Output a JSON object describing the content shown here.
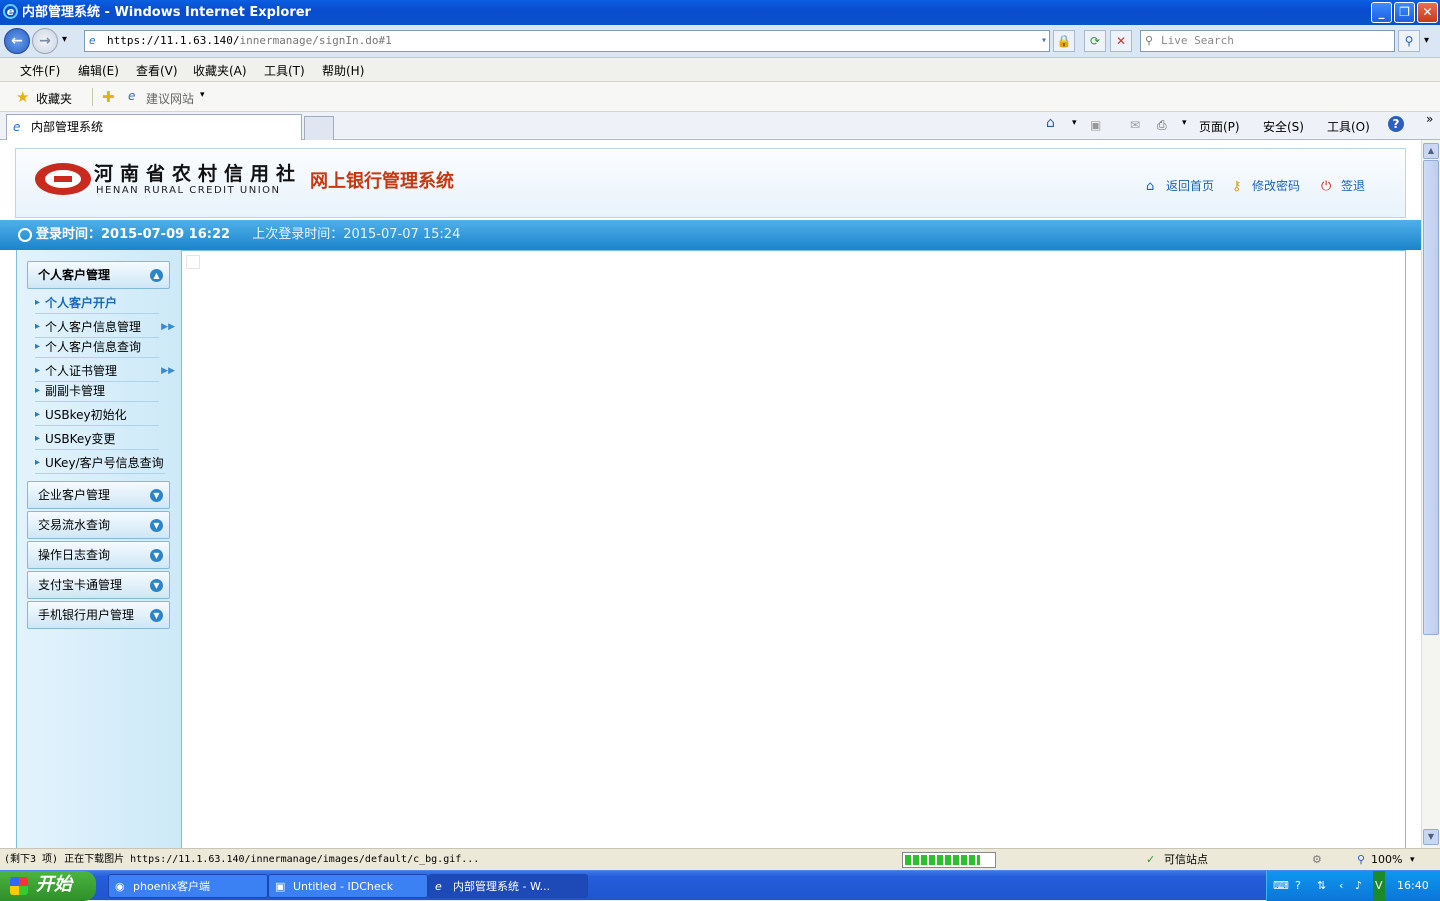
{
  "window": {
    "title": "内部管理系统 - Windows Internet Explorer"
  },
  "address": {
    "prefix": "https://11.1.63.140/",
    "path": "innermanage/signIn.do#1"
  },
  "search": {
    "placeholder": "Live Search"
  },
  "menu": [
    "文件(F)",
    "编辑(E)",
    "查看(V)",
    "收藏夹(A)",
    "工具(T)",
    "帮助(H)"
  ],
  "favorites": {
    "label": "收藏夹",
    "suggested": "建议网站"
  },
  "tab": {
    "title": "内部管理系统"
  },
  "commands": {
    "page": "页面(P)",
    "safety": "安全(S)",
    "tools": "工具(O)",
    "help": "?"
  },
  "banner": {
    "bank_cn": "河南省农村信用社",
    "bank_en": "HENAN RURAL CREDIT UNION",
    "system_title": "网上银行管理系统",
    "home": "返回首页",
    "change_password": "修改密码",
    "logout": "签退"
  },
  "info": {
    "login_label": "登录时间：2015-07-09 16:22",
    "last_login": "上次登录时间：2015-07-07 15:24"
  },
  "sidebar": {
    "group1": "个人客户管理",
    "items": [
      "个人客户开户",
      "个人客户信息管理",
      "个人客户信息查询",
      "个人证书管理",
      "副副卡管理",
      "USBkey初始化",
      "USBKey变更",
      "UKey/客户号信息查询"
    ],
    "groups": [
      "企业客户管理",
      "交易流水查询",
      "操作日志查询",
      "支付宝卡通管理",
      "手机银行用户管理"
    ]
  },
  "status": {
    "text": "(剩下3 项) 正在下载图片 https://11.1.63.140/innermanage/images/default/c_bg.gif...",
    "zone": "可信站点",
    "zoom": "100%",
    "progress": 0.85
  },
  "taskbar": {
    "start": "开始",
    "tasks": [
      "phoenix客户端",
      "Untitled - IDCheck",
      "内部管理系统 - W..."
    ],
    "clock": "16:40"
  }
}
